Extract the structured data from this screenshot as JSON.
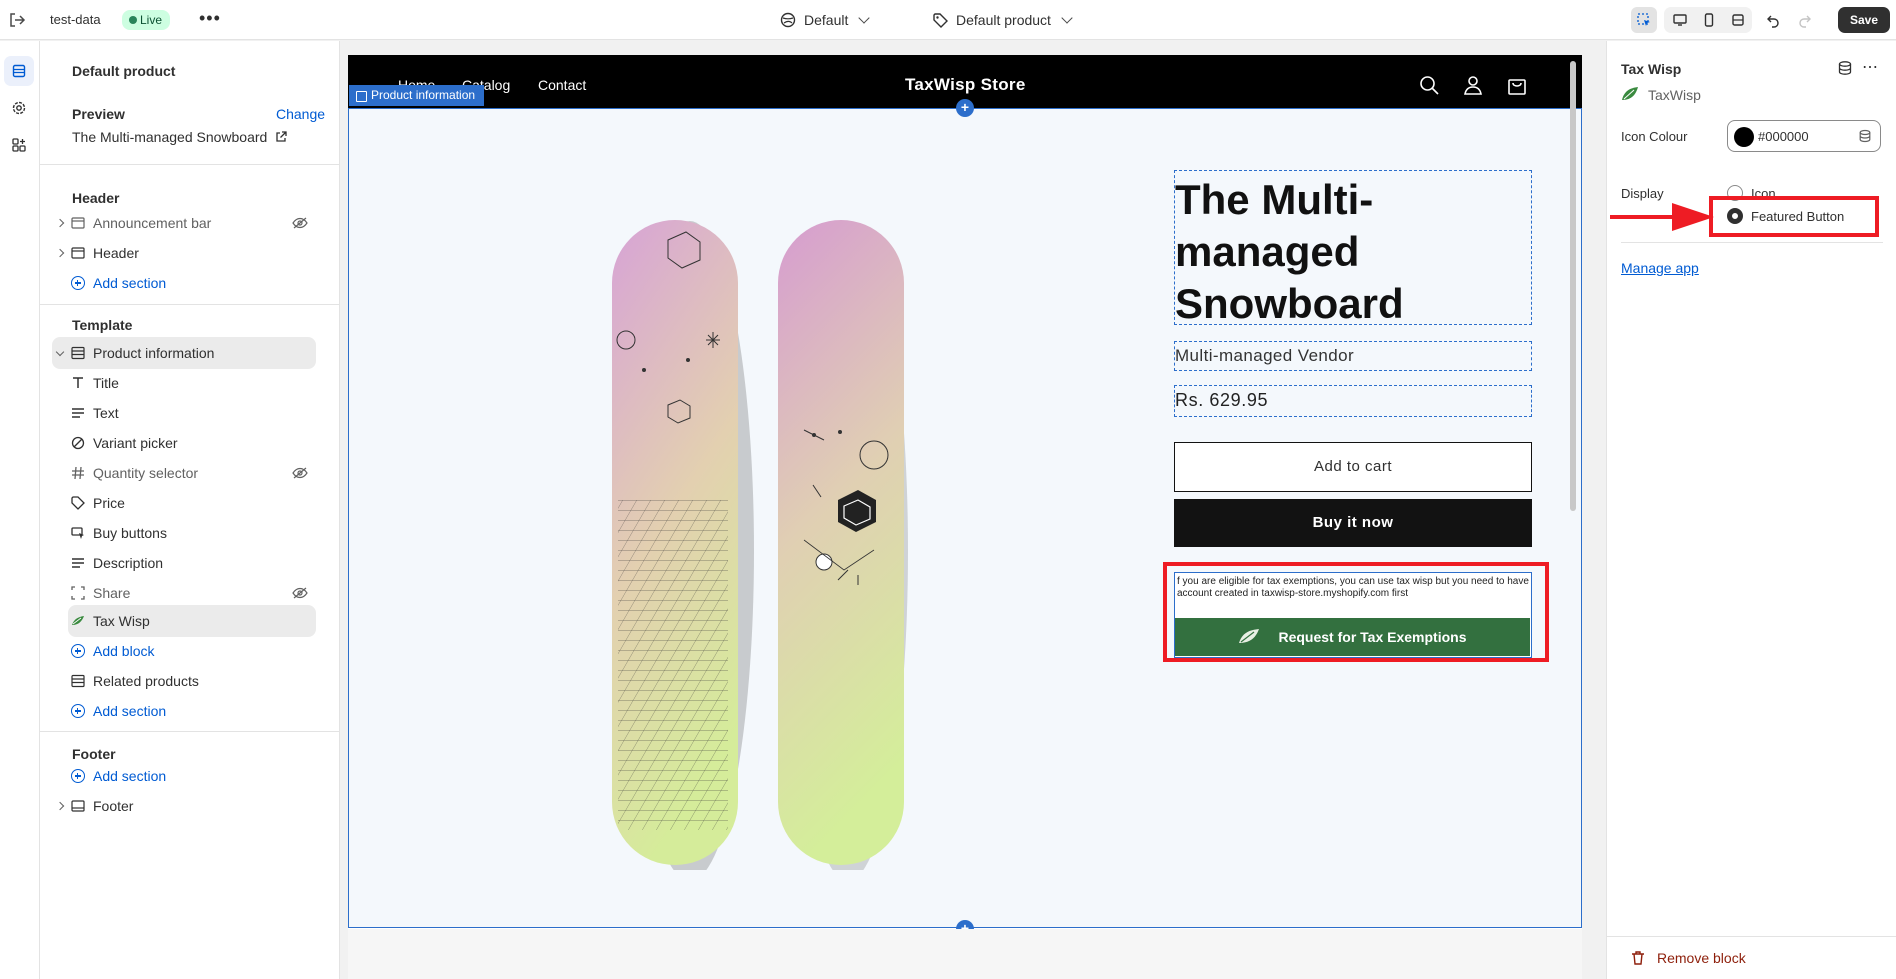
{
  "topbar": {
    "store_name": "test-data",
    "live_badge": "Live",
    "more": "•••",
    "theme_label": "Default",
    "template_label": "Default product",
    "save_label": "Save"
  },
  "sidebar": {
    "title": "Default product",
    "preview_label": "Preview",
    "change_label": "Change",
    "preview_value": "The Multi-managed Snowboard",
    "header_group": "Header",
    "header_items": [
      {
        "label": "Announcement bar"
      },
      {
        "label": "Header"
      }
    ],
    "add_section": "Add section",
    "template_group": "Template",
    "product_information": "Product information",
    "blocks": [
      {
        "label": "Title"
      },
      {
        "label": "Text"
      },
      {
        "label": "Variant picker"
      },
      {
        "label": "Quantity selector"
      },
      {
        "label": "Price"
      },
      {
        "label": "Buy buttons"
      },
      {
        "label": "Description"
      },
      {
        "label": "Share"
      },
      {
        "label": "Tax Wisp"
      }
    ],
    "add_block": "Add block",
    "related_products": "Related products",
    "footer_group": "Footer",
    "footer_item": "Footer"
  },
  "store": {
    "nav_links": [
      "Home",
      "Catalog",
      "Contact"
    ],
    "logo": "TaxWisp Store",
    "section_tag": "Product information",
    "product_title": "The Multi-managed Snowboard",
    "vendor": "Multi-managed Vendor",
    "price": "Rs. 629.95",
    "add_to_cart": "Add to cart",
    "buy_now": "Buy it now",
    "tax_note": "f you are eligible for tax exemptions, you can use tax wisp but you need to have account created in taxwisp-store.myshopify.com first",
    "tax_button": "Request for Tax Exemptions",
    "snowboard_colors": {
      "top": "#d9a6d6",
      "bottom": "#d8ec9c"
    }
  },
  "right_panel": {
    "title": "Tax Wisp",
    "app_name": "TaxWisp",
    "icon_colour_label": "Icon Colour",
    "icon_colour_value": "#000000",
    "display_label": "Display",
    "display_options": [
      {
        "label": "Icon",
        "checked": false
      },
      {
        "label": "Featured Button",
        "checked": true
      }
    ],
    "manage_app": "Manage app",
    "remove_block": "Remove block"
  },
  "colors": {
    "accent": "#2c6ecb",
    "link": "#005bd3",
    "tax_button_bg": "#33703f",
    "annotation_red": "#ee1c24"
  }
}
